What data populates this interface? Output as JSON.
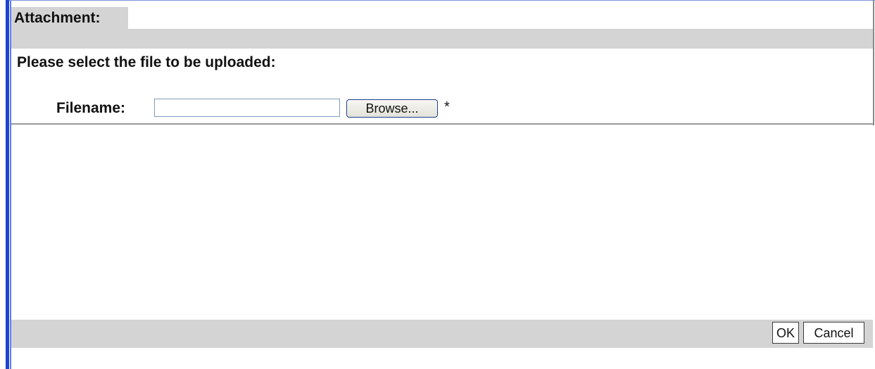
{
  "dialog": {
    "title": "Attachment:"
  },
  "upload": {
    "prompt": "Please select the file to be uploaded:",
    "filename_label": "Filename:",
    "filename_value": "",
    "browse_label": "Browse...",
    "required_marker": "*"
  },
  "footer": {
    "ok_label": "OK",
    "cancel_label": "Cancel"
  },
  "colors": {
    "accent_bar": "#1a44d6",
    "panel_gray": "#d4d4d4"
  }
}
